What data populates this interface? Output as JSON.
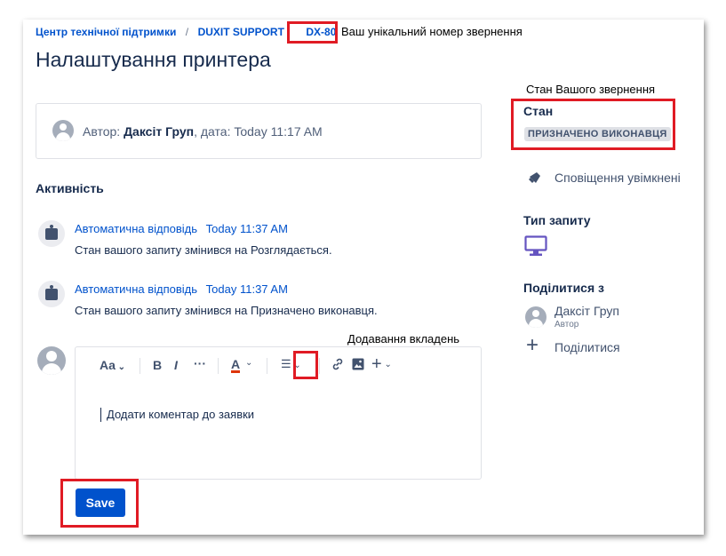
{
  "breadcrumb": {
    "items": [
      "Центр технічної підтримки",
      "DUXIT SUPPORT",
      "DX-80"
    ],
    "separator": "/"
  },
  "annotations": {
    "request_number": "Ваш унікальний номер звернення",
    "request_status": "Стан Вашого звернення",
    "attachments": "Додавання вкладень"
  },
  "page_title": "Налаштування принтера",
  "author_line": {
    "prefix": "Автор: ",
    "name": "Даксіт Груп",
    "date_part": ", дата: Today 11:17 AM"
  },
  "activity": {
    "heading": "Активність",
    "items": [
      {
        "author": "Автоматична відповідь",
        "time": "Today 11:37 AM",
        "text": "Стан вашого запиту змінився на Розглядається."
      },
      {
        "author": "Автоматична відповідь",
        "time": "Today 11:37 AM",
        "text": "Стан вашого запиту змінився на Призначено виконавця."
      }
    ]
  },
  "editor": {
    "toolbar": {
      "text_style": "Aa",
      "bold": "B",
      "italic": "I",
      "more": "···",
      "color": "A",
      "list": "☰",
      "link": "🔗",
      "insert": "+"
    },
    "placeholder": "Додати коментар до заявки",
    "save_label": "Save"
  },
  "sidebar": {
    "status_label": "Стан",
    "status_value": "ПРИЗНАЧЕНО ВИКОНАВЦЯ",
    "notifications": "Сповіщення увімкнені",
    "request_type_label": "Тип запиту",
    "share_label": "Поділитися з",
    "participant_name": "Даксіт Груп",
    "participant_role": "Автор",
    "share_action": "Поділитися"
  },
  "colors": {
    "accent": "#0052cc",
    "highlight": "#e01b24",
    "request_type_icon": "#6554c0"
  }
}
